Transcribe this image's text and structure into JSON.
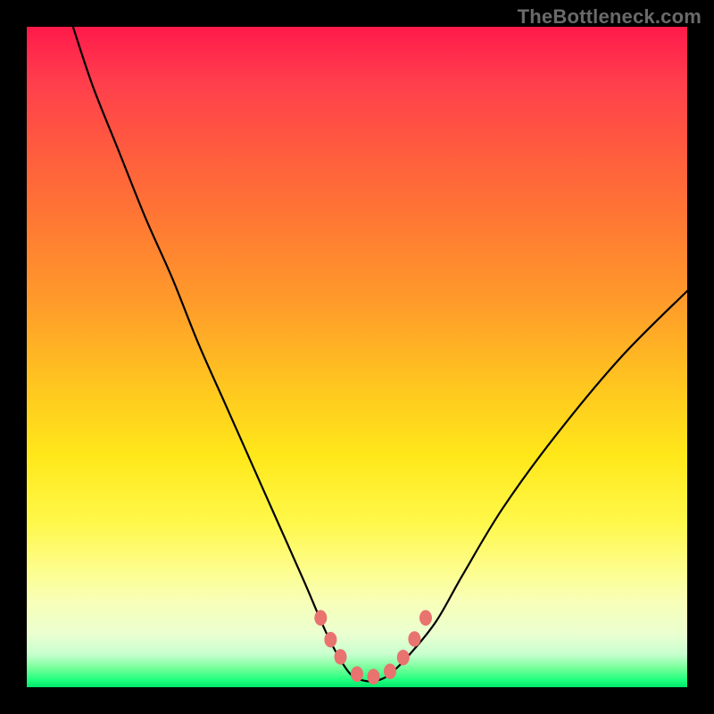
{
  "watermark": "TheBottleneck.com",
  "colors": {
    "frame_border": "#000000",
    "curve_stroke": "#000000",
    "bead_fill": "#e8736f",
    "gradient_top": "#ff1a4a",
    "gradient_mid": "#ffe81a",
    "gradient_bottom": "#00e56b"
  },
  "chart_data": {
    "type": "line",
    "title": "",
    "xlabel": "",
    "ylabel": "",
    "xlim": [
      0,
      100
    ],
    "ylim": [
      0,
      100
    ],
    "note": "Qualitative bottleneck curve. x is an arbitrary 0-100 component-rating axis; y is a 0-100 bottleneck score (0 = bottom/green, 100 = top/red). Values are estimated from pixel positions against the 740x740 plot box.",
    "series": [
      {
        "name": "bottleneck_curve",
        "x": [
          7,
          10,
          14,
          18,
          22,
          26,
          30,
          34,
          38,
          42,
          45,
          47,
          49,
          51,
          53,
          55,
          58,
          62,
          66,
          72,
          80,
          90,
          100
        ],
        "y": [
          100,
          91,
          81,
          71,
          62,
          52,
          43,
          34,
          25,
          16,
          9,
          5,
          2,
          1,
          1,
          2,
          5,
          10,
          17,
          27,
          38,
          50,
          60
        ]
      },
      {
        "name": "marker_beads",
        "x": [
          44.5,
          46.0,
          47.5,
          50.0,
          52.5,
          55.0,
          57.0,
          58.7,
          60.4
        ],
        "y": [
          10.5,
          7.2,
          4.6,
          2.0,
          1.6,
          2.4,
          4.5,
          7.3,
          10.5
        ]
      }
    ],
    "bead_radius_px": 7
  }
}
